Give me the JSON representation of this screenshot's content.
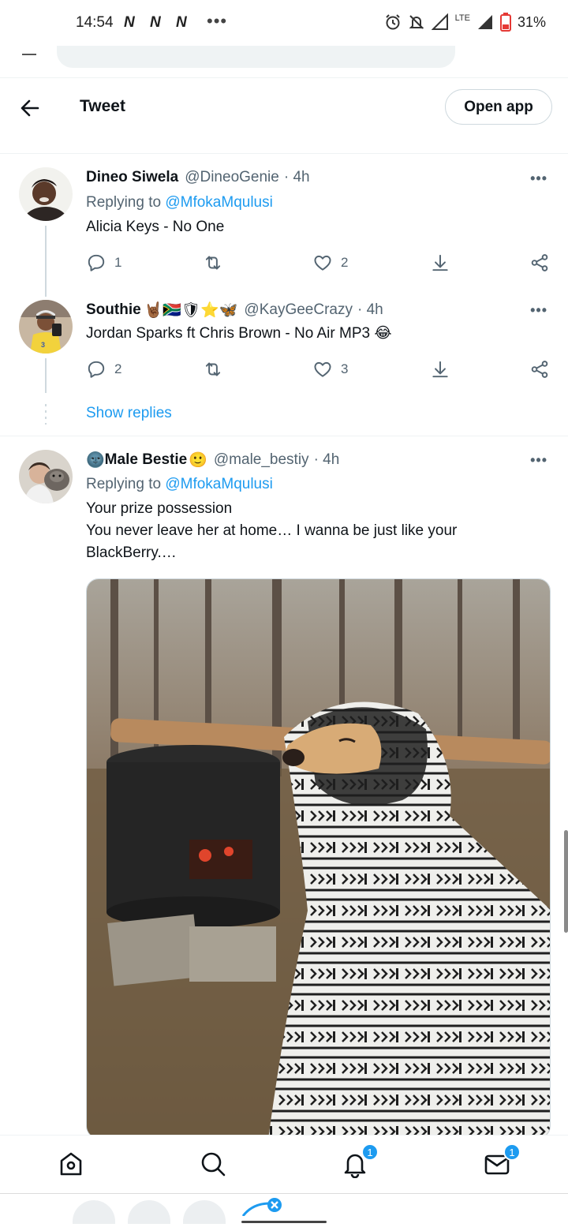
{
  "status_bar": {
    "time": "14:54",
    "notif_letters": [
      "N",
      "N",
      "N"
    ],
    "more": "•••",
    "network": "LTE",
    "battery": "31%"
  },
  "header": {
    "title": "Tweet",
    "open_app_label": "Open app"
  },
  "tweets": [
    {
      "name": "Dineo Siwela",
      "handle": "@DineoGenie",
      "time": "· 4h",
      "replying_prefix": "Replying to",
      "replying_to": "@MfokaMqulusi",
      "text": "Alicia Keys - No One",
      "replies": "1",
      "retweets": "",
      "likes": "2"
    },
    {
      "name": "Southie",
      "name_emoji": "🤘🏾🇿🇦🛡⭐🦋",
      "handle": "@KayGeeCrazy",
      "time": "· 4h",
      "text": "Jordan Sparks ft Chris Brown - No Air MP3 😂",
      "replies": "2",
      "retweets": "",
      "likes": "3",
      "show_replies_label": "Show replies"
    },
    {
      "name_prefix_emoji": "🌚",
      "name": "Male Bestie",
      "name_suffix_emoji": "🙂",
      "handle": "@male_bestiy",
      "time": "· 4h",
      "replying_prefix": "Replying to",
      "replying_to": "@MfokaMqulusi",
      "text_line1": "Your prize possession",
      "text_line2": "You never leave her at home… I wanna be just like your BlackBerry.…"
    }
  ],
  "bottom_nav": {
    "notifications_badge": "1",
    "messages_badge": "1"
  },
  "colors": {
    "accent": "#1d9bf0",
    "text_primary": "#0f1419",
    "text_secondary": "#536471",
    "border": "#eff3f4"
  }
}
